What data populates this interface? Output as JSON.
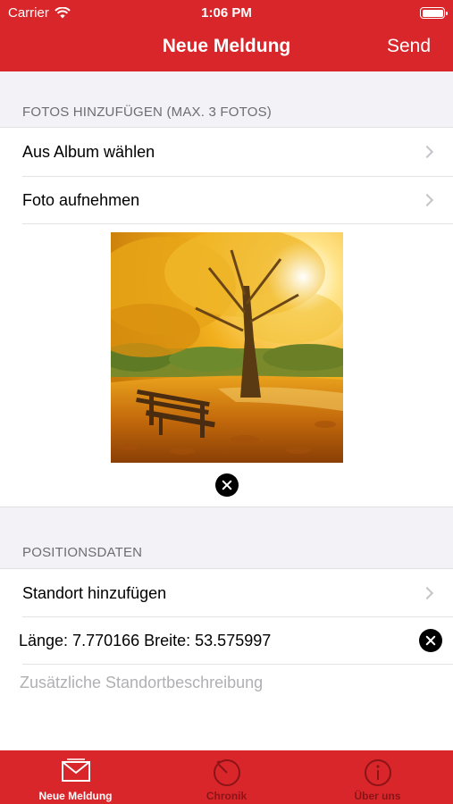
{
  "status_bar": {
    "carrier": "Carrier",
    "time": "1:06 PM"
  },
  "nav": {
    "title": "Neue Meldung",
    "send_label": "Send"
  },
  "photos_section": {
    "header": "FOTOS HINZUFÜGEN (MAX. 3 FOTOS)",
    "rows": [
      {
        "label": "Aus Album wählen"
      },
      {
        "label": "Foto aufnehmen"
      }
    ]
  },
  "position_section": {
    "header": "POSITIONSDATEN",
    "add_location_label": "Standort hinzufügen",
    "coordinates_text": "Länge: 7.770166 Breite: 53.575997",
    "description_placeholder": "Zusätzliche Standortbeschreibung"
  },
  "tabbar": {
    "tabs": [
      {
        "label": "Neue Meldung",
        "icon": "envelope-icon",
        "active": true
      },
      {
        "label": "Chronik",
        "icon": "history-clock-icon",
        "active": false
      },
      {
        "label": "Über uns",
        "icon": "info-icon",
        "active": false
      }
    ]
  },
  "colors": {
    "brand_red": "#d9262b",
    "background": "#f2f2f7",
    "inactive_tab": "#8c1417"
  }
}
